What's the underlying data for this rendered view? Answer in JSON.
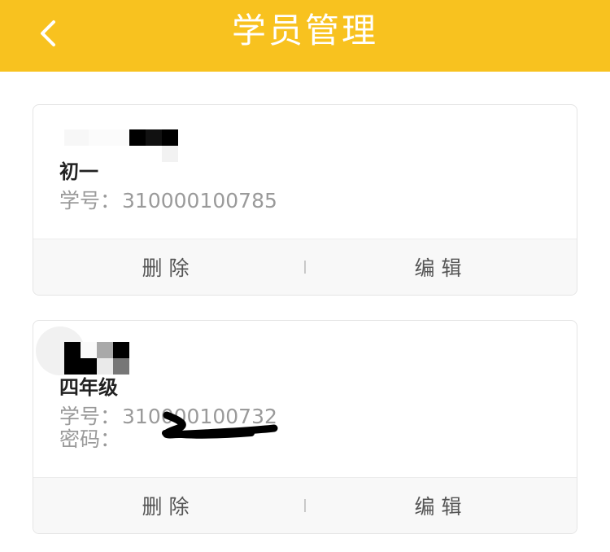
{
  "header": {
    "title": "学员管理",
    "back_icon": "chevron-left-icon",
    "background": "#f8c21f"
  },
  "students": [
    {
      "grade": "初一",
      "student_id_label": "学号：",
      "student_id": "310000100785",
      "delete_label": "删除",
      "edit_label": "编辑"
    },
    {
      "grade": "四年级",
      "student_id_label": "学号：",
      "student_id": "310000100732",
      "password_label": "密码：",
      "delete_label": "删除",
      "edit_label": "编辑"
    }
  ]
}
